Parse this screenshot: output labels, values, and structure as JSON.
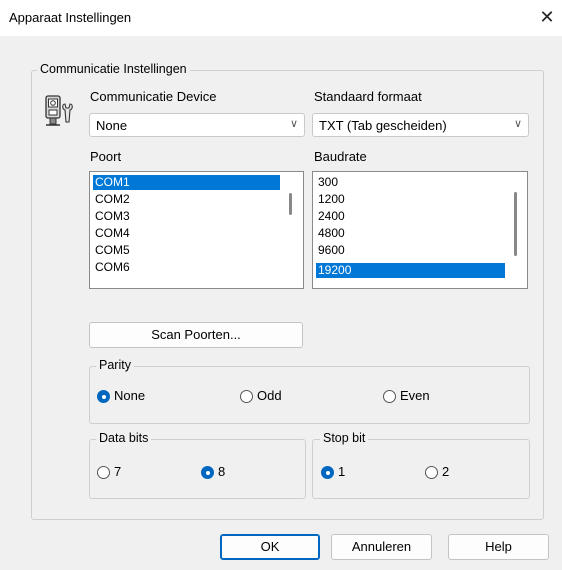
{
  "window": {
    "title": "Apparaat Instellingen",
    "close_glyph": "✕"
  },
  "comm_group": {
    "legend": "Communicatie Instellingen"
  },
  "device": {
    "label": "Communicatie Device",
    "value": "None",
    "icon": "serial-device-icon"
  },
  "format": {
    "label": "Standaard formaat",
    "value": "TXT (Tab gescheiden)"
  },
  "port": {
    "label": "Poort",
    "items": [
      "COM1",
      "COM2",
      "COM3",
      "COM4",
      "COM5",
      "COM6"
    ],
    "selected": "COM1"
  },
  "baud": {
    "label": "Baudrate",
    "items": [
      "300",
      "1200",
      "2400",
      "4800",
      "9600",
      "19200"
    ],
    "selected": "19200"
  },
  "scan_button": "Scan Poorten...",
  "parity": {
    "legend": "Parity",
    "options": [
      "None",
      "Odd",
      "Even"
    ],
    "selected": "None"
  },
  "data_bits": {
    "legend": "Data bits",
    "options": [
      "7",
      "8"
    ],
    "selected": "8"
  },
  "stop_bit": {
    "legend": "Stop bit",
    "options": [
      "1",
      "2"
    ],
    "selected": "1"
  },
  "buttons": {
    "ok": "OK",
    "cancel": "Annuleren",
    "help": "Help"
  },
  "colors": {
    "accent": "#0078d7",
    "radio_on": "#0067c0"
  }
}
